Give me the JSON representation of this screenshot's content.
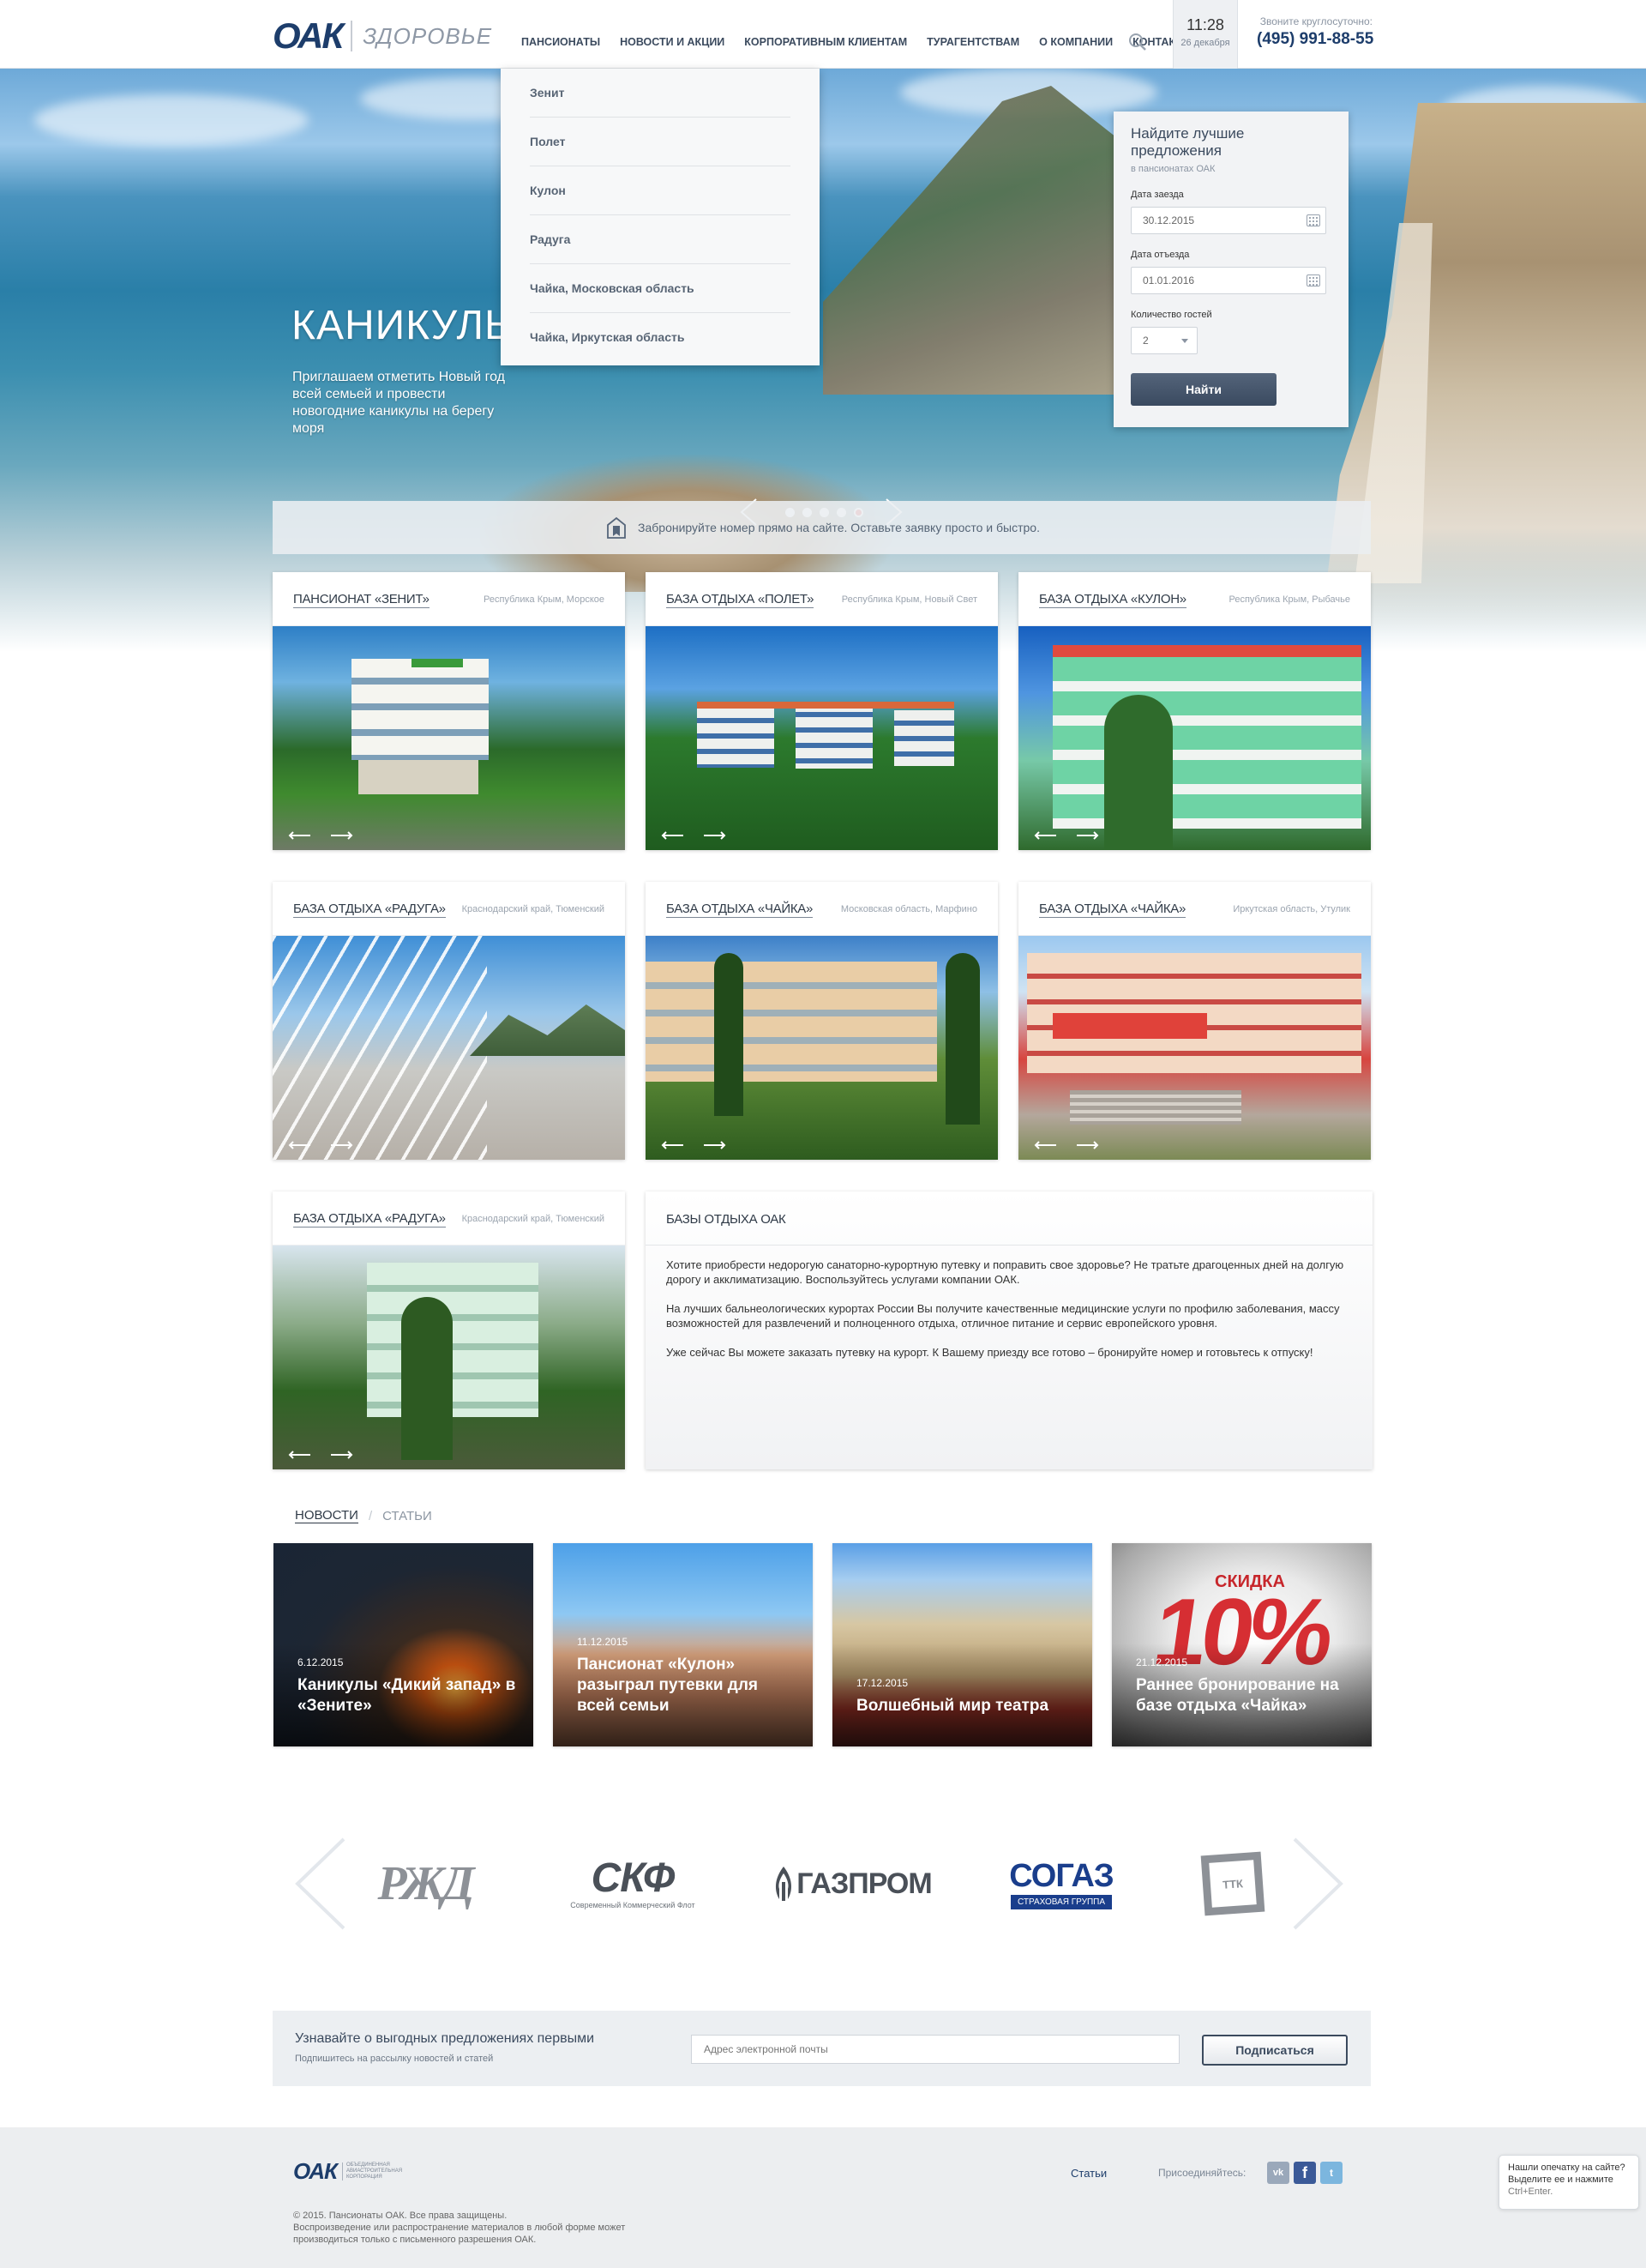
{
  "header": {
    "logo_main": "ОАК",
    "logo_sub": "ЗДОРОВЬЕ",
    "nav": [
      "ПАНСИОНАТЫ",
      "НОВОСТИ И АКЦИИ",
      "КОРПОРАТИВНЫМ КЛИЕНТАМ",
      "ТУРАГЕНТСТВАМ",
      "О КОМПАНИИ",
      "КОНТАКТЫ"
    ],
    "time": "11:28",
    "date": "26 декабря",
    "call_label": "Звоните круглосуточно:",
    "phone": "(495) 991-88-55"
  },
  "dropdown": [
    "Зенит",
    "Полет",
    "Кулон",
    "Радуга",
    "Чайка, Московская область",
    "Чайка, Иркутская область"
  ],
  "hero": {
    "title": "КАНИКУЛЫ",
    "desc": "Приглашаем отметить Новый год всей семьей и провести новогодние каникулы на берегу моря",
    "slides_total": 5,
    "active_slide": 5
  },
  "booking": {
    "title": "Найдите лучшие предложения",
    "subtitle": "в пансионатах ОАК",
    "checkin_label": "Дата заезда",
    "checkin_value": "30.12.2015",
    "checkout_label": "Дата отъезда",
    "checkout_value": "01.01.2016",
    "guests_label": "Количество гостей",
    "guests_value": "2",
    "button": "Найти"
  },
  "strip_text": "Забронируйте номер прямо на сайте. Оставьте заявку просто и быстро.",
  "cards": [
    {
      "title": "ПАНСИОНАТ «ЗЕНИТ»",
      "location": "Республика Крым, Морское"
    },
    {
      "title": "БАЗА ОТДЫХА «ПОЛЕТ»",
      "location": "Республика Крым, Новый Свет"
    },
    {
      "title": "БАЗА ОТДЫХА «КУЛОН»",
      "location": "Республика Крым, Рыбачье"
    },
    {
      "title": "БАЗА ОТДЫХА «РАДУГА»",
      "location": "Краснодарский край, Тюменский"
    },
    {
      "title": "БАЗА ОТДЫХА «ЧАЙКА»",
      "location": "Московская область, Марфино"
    },
    {
      "title": "БАЗА ОТДЫХА «ЧАЙКА»",
      "location": "Иркутская область, Утулик"
    },
    {
      "title": "БАЗА ОТДЫХА «РАДУГА»",
      "location": "Краснодарский край, Тюменский"
    }
  ],
  "about": {
    "title": "БАЗЫ ОТДЫХА ОАК",
    "paragraphs": [
      "Хотите приобрести недорогую санаторно-курортную путевку и поправить свое здоровье? Не тратьте драгоценных дней на долгую дорогу и акклиматизацию. Воспользуйтесь услугами компании ОАК.",
      "На лучших бальнеологических курортах России Вы получите качественные медицинские услуги по профилю заболевания, массу возможностей для развлечений и полноценного отдыха, отличное питание и сервис европейского уровня.",
      "Уже сейчас Вы можете заказать путевку на курорт. К Вашему приезду все готово – бронируйте номер и готовьтесь к отпуску!"
    ]
  },
  "news": {
    "tab_active": "НОВОСТИ",
    "tab_inactive": "СТАТЬИ",
    "items": [
      {
        "date": "6.12.2015",
        "title": "Каникулы «Дикий запад» в «Зените»"
      },
      {
        "date": "11.12.2015",
        "title": "Пансионат «Кулон» разыграл путевки для всей семьи"
      },
      {
        "date": "17.12.2015",
        "title": "Волшебный мир театра"
      },
      {
        "date": "21.12.2015",
        "title": "Раннее бронирование на базе отдыха «Чайка»",
        "badge_top": "СКИДКА",
        "badge_big": "10%"
      }
    ]
  },
  "partners": {
    "rzd": "РЖД",
    "skf": "СКФ",
    "skf_sub": "Современный Коммерческий Флот",
    "gazprom": "ГАЗПРОМ",
    "sogaz": "СОГАЗ",
    "sogaz_sub": "СТРАХОВАЯ ГРУППА",
    "ttk": "ТТК"
  },
  "subscribe": {
    "title": "Узнавайте о выгодных предложениях первыми",
    "subtitle": "Подпишитесь на рассылку новостей и статей",
    "placeholder": "Адрес электронной почты",
    "button": "Подписаться"
  },
  "footer": {
    "logo": "ОАК",
    "logo_desc": "ОБЪЕДИНЕННАЯ АВИАСТРОИТЕЛЬНАЯ КОРПОРАЦИЯ",
    "copyright": "© 2015. Пансионаты ОАК. Все права защищены.",
    "copyright2": "Воспроизведение или распространение материалов в любой форме может производиться только с письменного разрешения ОАК.",
    "link_articles": "Статьи",
    "join_label": "Присоединяйтесь:",
    "social": {
      "vk": "vk",
      "fb": "f",
      "tw": "t"
    }
  },
  "typo_notice": {
    "line1": "Нашли опечатку на сайте?",
    "line2": "Выделите ее и нажмите",
    "hint": "Ctrl+Enter."
  },
  "colors": {
    "brand_blue": "#1d3d6b",
    "brand_red": "#c62d2d",
    "active_dot": "#e04848"
  }
}
